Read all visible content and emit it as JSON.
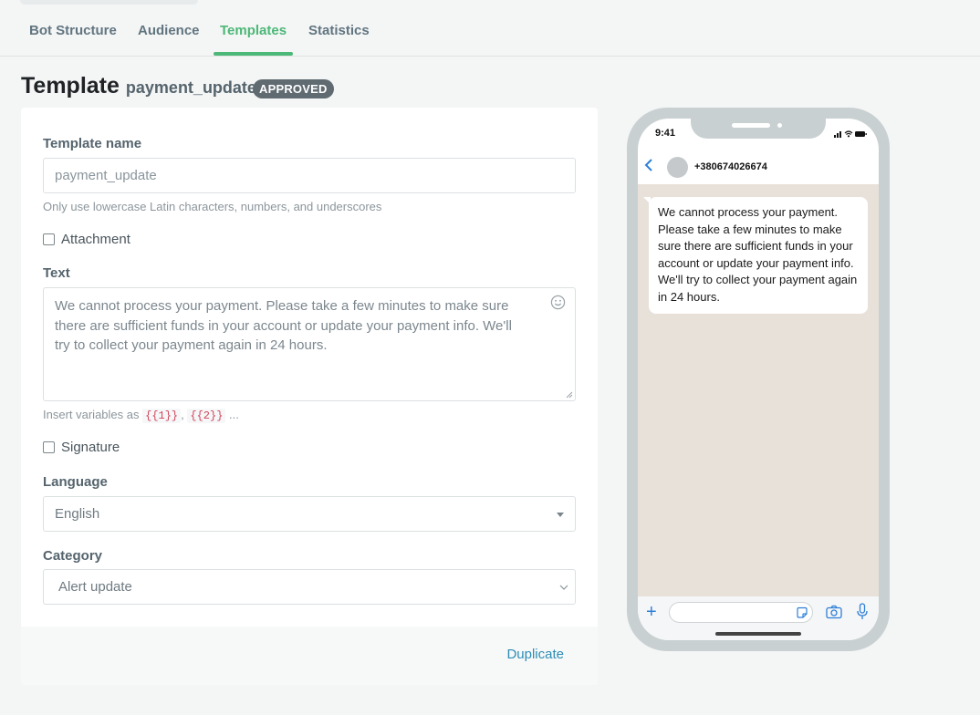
{
  "tabs": [
    {
      "label": "Bot Structure"
    },
    {
      "label": "Audience"
    },
    {
      "label": "Templates"
    },
    {
      "label": "Statistics"
    }
  ],
  "header": {
    "title": "Template",
    "template_id": "payment_update",
    "status_badge": "APPROVED"
  },
  "form": {
    "template_name_label": "Template name",
    "template_name_placeholder": "payment_update",
    "template_name_hint": "Only use lowercase Latin characters, numbers, and underscores",
    "attachment_label": "Attachment",
    "text_label": "Text",
    "text_value": "We cannot process your payment. Please take a few minutes to make sure there are sufficient funds in your account or update your payment info. We'll try to collect your payment again in 24 hours.",
    "variables_hint_prefix": "Insert variables as",
    "variable_1": "{{1}}",
    "variable_sep": ",",
    "variable_2": "{{2}}",
    "variables_hint_suffix": "...",
    "signature_label": "Signature",
    "language_label": "Language",
    "language_value": "English",
    "category_label": "Category",
    "category_value": "Alert update",
    "duplicate_button": "Duplicate"
  },
  "preview": {
    "time": "9:41",
    "contact": "+380674026674",
    "message": "We cannot process your payment. Please take a few minutes to make sure there are sufficient funds in your account or update your payment info. We'll try to collect your payment again in 24 hours."
  },
  "colors": {
    "accent": "#4cb877",
    "badge": "#5f6a71",
    "link": "#2e8db5"
  }
}
